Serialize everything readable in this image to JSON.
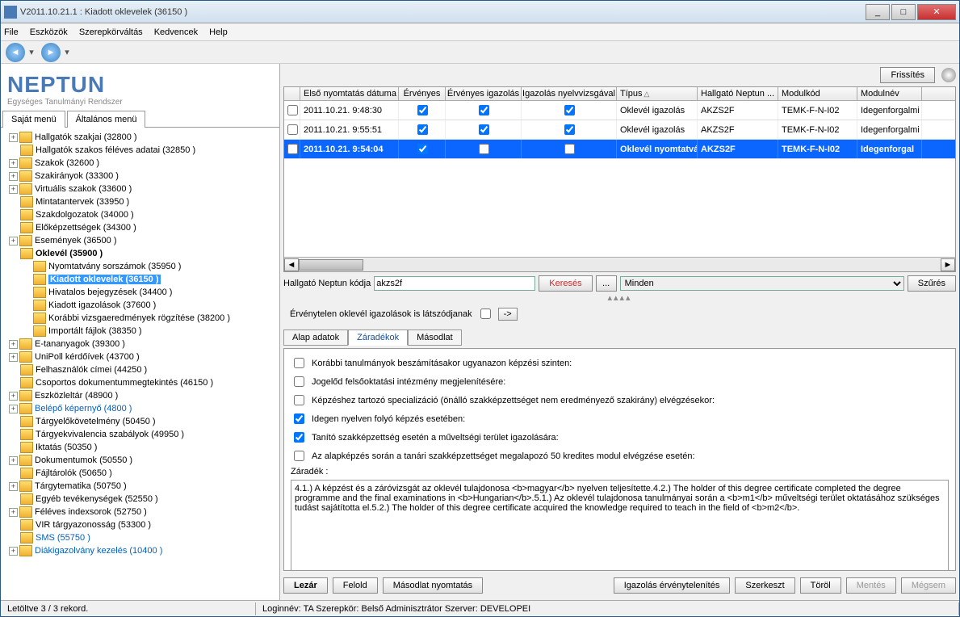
{
  "window": {
    "title": "V2011.10.21.1 : Kiadott oklevelek (36150  )"
  },
  "menu": {
    "file": "File",
    "tools": "Eszközök",
    "role": "Szerepkörváltás",
    "fav": "Kedvencek",
    "help": "Help"
  },
  "logo": {
    "brand": "NEPTUN",
    "sub": "Egységes Tanulmányi Rendszer"
  },
  "left_tabs": {
    "t1": "Saját menü",
    "t2": "Általános menü"
  },
  "tree": [
    {
      "t": "Hallgatók szakjai (32800  )",
      "exp": true
    },
    {
      "t": "Hallgatók szakos féléves adatai (32850  )"
    },
    {
      "t": "Szakok (32600  )",
      "exp": true
    },
    {
      "t": "Szakirányok (33300  )",
      "exp": true
    },
    {
      "t": "Virtuális szakok (33600  )",
      "exp": true
    },
    {
      "t": "Mintatantervek (33950  )"
    },
    {
      "t": "Szakdolgozatok (34000  )"
    },
    {
      "t": "Előképzettségek (34300  )"
    },
    {
      "t": "Események (36500  )",
      "exp": true
    },
    {
      "t": "Oklevél (35900  )",
      "bold": true
    },
    {
      "t": "Nyomtatvány sorszámok (35950  )",
      "l": 2
    },
    {
      "t": "Kiadott oklevelek (36150  )",
      "l": 2,
      "sel": true
    },
    {
      "t": "Hivatalos bejegyzések (34400  )",
      "l": 2
    },
    {
      "t": "Kiadott igazolások (37600  )",
      "l": 2
    },
    {
      "t": "Korábbi vizsgaeredmények rögzítése (38200  )",
      "l": 2
    },
    {
      "t": "Importált fájlok (38350  )",
      "l": 2
    },
    {
      "t": "E-tananyagok (39300  )",
      "exp": true
    },
    {
      "t": "UniPoll kérdőívek (43700  )",
      "exp": true
    },
    {
      "t": "Felhasználók címei (44250  )"
    },
    {
      "t": "Csoportos dokumentummegtekintés (46150  )"
    },
    {
      "t": "Eszközleltár (48900  )",
      "exp": true
    },
    {
      "t": "Belépő képernyő (4800  )",
      "exp": true,
      "blue": true
    },
    {
      "t": "Tárgyelőkövetelmény (50450  )"
    },
    {
      "t": "Tárgyekvivalencia szabályok (49950  )"
    },
    {
      "t": "Iktatás (50350  )"
    },
    {
      "t": "Dokumentumok (50550  )",
      "exp": true
    },
    {
      "t": "Fájltárolók (50650  )"
    },
    {
      "t": "Tárgytematika (50750  )",
      "exp": true
    },
    {
      "t": "Egyéb tevékenységek (52550  )"
    },
    {
      "t": "Féléves indexsorok (52750  )",
      "exp": true
    },
    {
      "t": "VIR tárgyazonosság (53300  )"
    },
    {
      "t": "SMS (55750  )",
      "blue": true
    },
    {
      "t": "Diákigazolvány kezelés (10400  )",
      "exp": true,
      "blue": true
    }
  ],
  "refresh": "Frissítés",
  "grid": {
    "headers": {
      "date": "Első nyomtatás dátuma",
      "erv": "Érvényes",
      "eig": "Érvényes igazolás",
      "ny": "Igazolás nyelvvizsgával",
      "tip": "Típus",
      "hn": "Hallgató Neptun ...",
      "mod": "Modulkód",
      "modn": "Modulnév"
    },
    "rows": [
      {
        "date": "2011.10.21. 9:48:30",
        "erv": true,
        "eig": true,
        "ny": true,
        "tip": "Oklevél igazolás",
        "hn": "AKZS2F",
        "mod": "TEMK-F-N-I02",
        "modn": "Idegenforgalmi"
      },
      {
        "date": "2011.10.21. 9:55:51",
        "erv": true,
        "eig": true,
        "ny": true,
        "tip": "Oklevél igazolás",
        "hn": "AKZS2F",
        "mod": "TEMK-F-N-I02",
        "modn": "Idegenforgalmi"
      },
      {
        "date": "2011.10.21. 9:54:04",
        "erv": true,
        "eig": false,
        "ny": false,
        "tip": "Oklevél nyomtatvá",
        "hn": "AKZS2F",
        "mod": "TEMK-F-N-I02",
        "modn": "Idegenforgal",
        "sel": true
      }
    ]
  },
  "search": {
    "label": "Hallgató Neptun kódja",
    "value": "akzs2f",
    "btn": "Keresés",
    "dots": "...",
    "all": "Minden",
    "filter": "Szűrés"
  },
  "mid": {
    "label": "Érvénytelen oklevél igazolások is látszódjanak",
    "arrow": "->"
  },
  "detail_tabs": {
    "t1": "Alap adatok",
    "t2": "Záradékok",
    "t3": "Másodlat"
  },
  "checks": {
    "c1": "Korábbi tanulmányok beszámításakor ugyanazon képzési szinten:",
    "c2": "Jogelőd felsőoktatási intézmény megjelenítésére:",
    "c3": "Képzéshez tartozó specializáció (önálló szakképzettséget nem eredményező szakirány) elvégzésekor:",
    "c4": "Idegen nyelven folyó képzés esetében:",
    "c5": "Tanító szakképzettség esetén a műveltségi terület igazolására:",
    "c6": "Az alapképzés során a tanári szakképzettséget megalapozó 50 kredites modul elvégzése esetén:"
  },
  "zaradek_label": "Záradék :",
  "zaradek_text": "4.1.) A képzést és a záróvizsgát az oklevél tulajdonosa <b>magyar</b> nyelven teljesítette.4.2.) The holder of this degree certificate completed the degree programme and the final examinations in <b>Hungarian</b>.5.1.) Az oklevél tulajdonosa tanulmányai során a <b>m1</b> műveltségi terület oktatásához szükséges tudást sajátította el.5.2.) The holder of this degree certificate acquired the knowledge required to teach in the field of <b>m2</b>.",
  "actions": {
    "lezar": "Lezár",
    "felold": "Felold",
    "masodlat": "Másodlat nyomtatás",
    "erv": "Igazolás érvénytelenítés",
    "szerk": "Szerkeszt",
    "torol": "Töröl",
    "mentes": "Mentés",
    "megsem": "Mégsem"
  },
  "status": {
    "left": "Letöltve 3 / 3 rekord.",
    "right": "Loginnév: TA   Szerepkör: Belső Adminisztrátor   Szerver: DEVELOPEI"
  }
}
